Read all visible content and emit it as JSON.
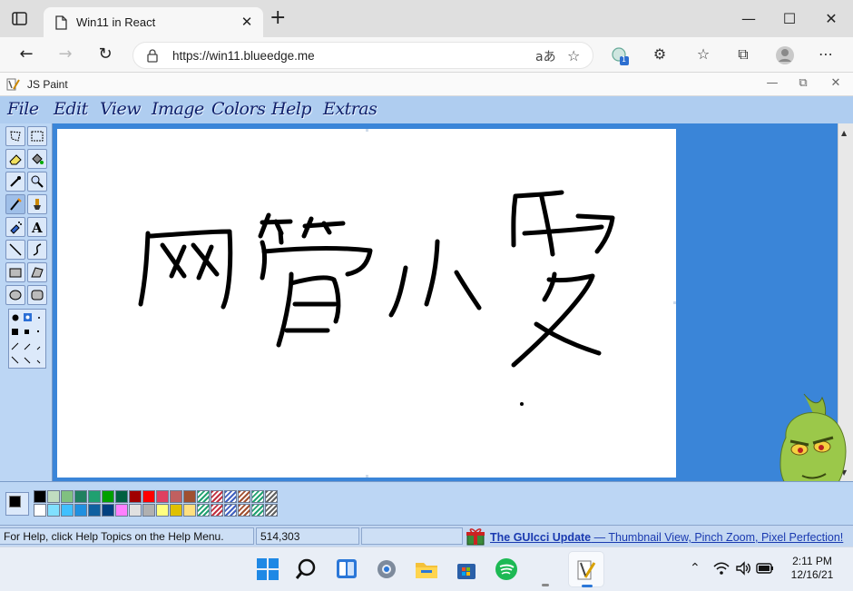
{
  "browser": {
    "tab_title": "Win11 in React",
    "url": "https://win11.blueedge.me",
    "extension_badge": "1"
  },
  "app": {
    "title": "JS Paint",
    "menu": [
      "File",
      "Edit",
      "View",
      "Image",
      "Colors",
      "Help",
      "Extras"
    ]
  },
  "canvas_drawing": {
    "characters": "网管小爱"
  },
  "palette": {
    "row1": [
      "#000000",
      "#c0dcc0",
      "#80c080",
      "#208060",
      "#20a070",
      "#00a000",
      "#006040",
      "#a00000",
      "#ff0000",
      "#e04060",
      "#c06060",
      "#a05030"
    ],
    "row2": [
      "#ffffff",
      "#80e0ff",
      "#40c0ff",
      "#2090e0",
      "#1060a0",
      "#004080",
      "#ff80ff",
      "#e0e0e0",
      "#b0b0b0",
      "#ffff80",
      "#e0c000",
      "#ffe080"
    ]
  },
  "status": {
    "help_text": "For Help, click Help Topics on the Help Menu.",
    "coords": "514,303",
    "news_title": "The GUIcci Update",
    "news_body": " — Thumbnail View, Pinch Zoom, Pixel Perfection!"
  },
  "taskbar": {
    "time": "2:11 PM",
    "date": "12/16/21"
  }
}
